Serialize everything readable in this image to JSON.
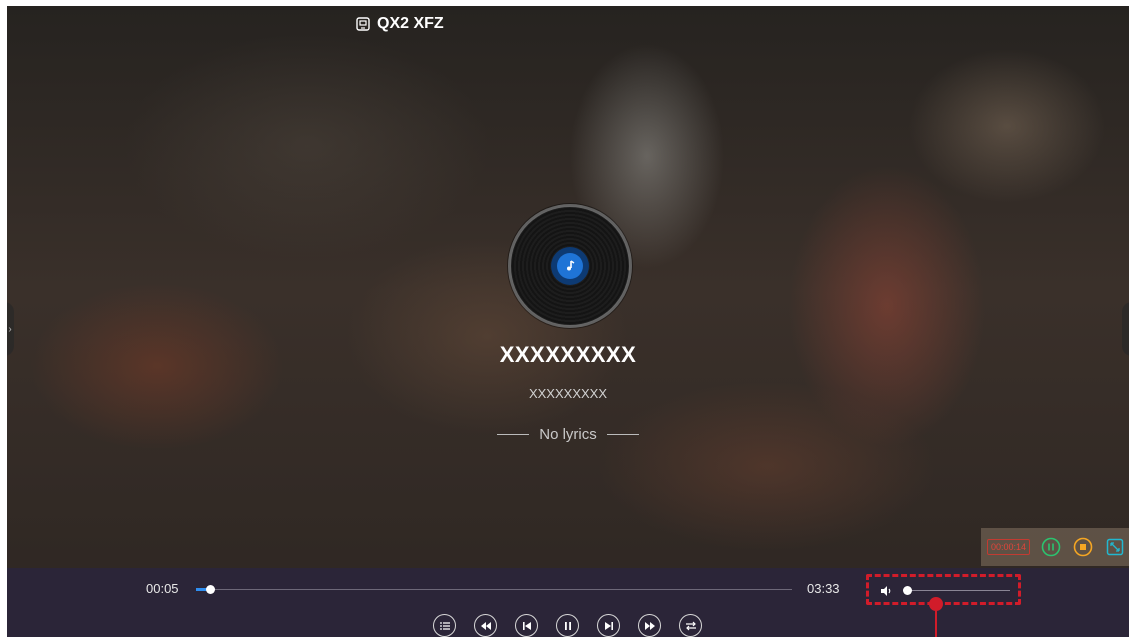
{
  "header": {
    "device_name": "QX2 XFZ",
    "device_icon": "cast-screen-icon"
  },
  "track": {
    "title": "XXXXXXXXX",
    "artist": "XXXXXXXXX",
    "lyrics": "No lyrics"
  },
  "player": {
    "elapsed": "00:05",
    "duration": "03:33",
    "progress_fraction": 0.024,
    "volume_fraction": 0.04
  },
  "recording": {
    "elapsed": "00:00:14"
  },
  "controls": [
    "playlist-icon",
    "rewind-icon",
    "previous-icon",
    "pause-icon",
    "next-icon",
    "fast-forward-icon",
    "repeat-mode-icon"
  ],
  "colors": {
    "accent": "#2f8ef0",
    "record_timer": "#e0453a",
    "pause_record": "#2bc36f",
    "stop_record": "#f5a623",
    "expand": "#22b8cf",
    "callout": "#d11c2a",
    "control_bar": "#2b2538"
  }
}
